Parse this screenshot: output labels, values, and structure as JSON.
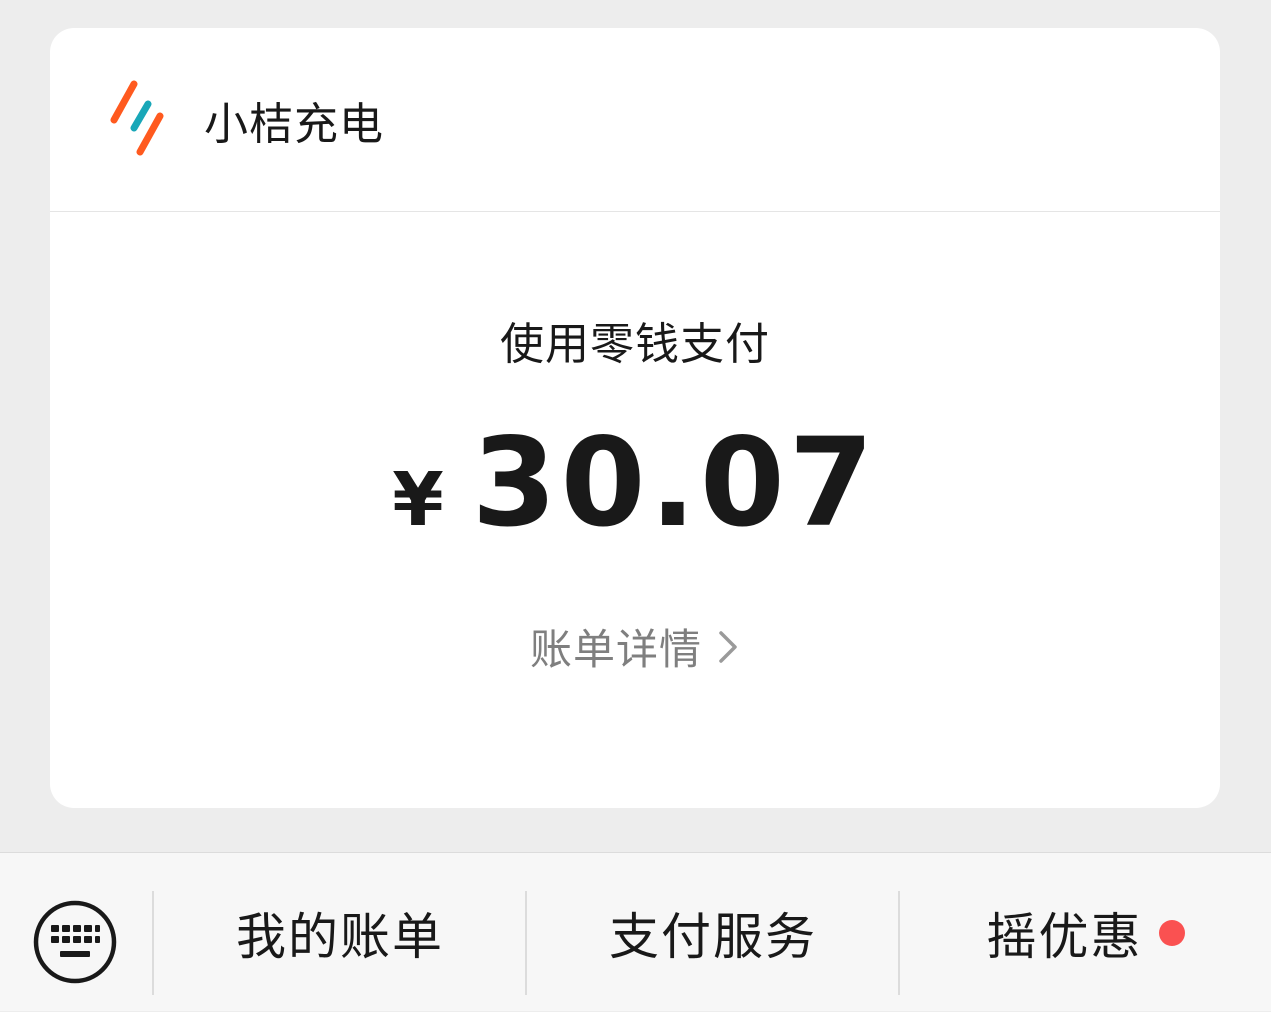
{
  "merchant": {
    "name": "小桔充电",
    "logo_icon": "xiaoju-charging-logo-icon"
  },
  "payment": {
    "method_label": "使用零钱支付",
    "currency_symbol": "¥",
    "amount": "30.07",
    "bill_details_label": "账单详情"
  },
  "bottom_bar": {
    "keyboard_icon": "keyboard-icon",
    "items": [
      {
        "label": "我的账单"
      },
      {
        "label": "支付服务"
      },
      {
        "label": "摇优惠",
        "has_badge": true
      }
    ]
  },
  "colors": {
    "background": "#ededed",
    "card": "#ffffff",
    "logo_orange": "#ff5a1f",
    "logo_teal": "#19a7b8",
    "badge_red": "#fa5151",
    "link_gray": "#7f7f7f"
  }
}
